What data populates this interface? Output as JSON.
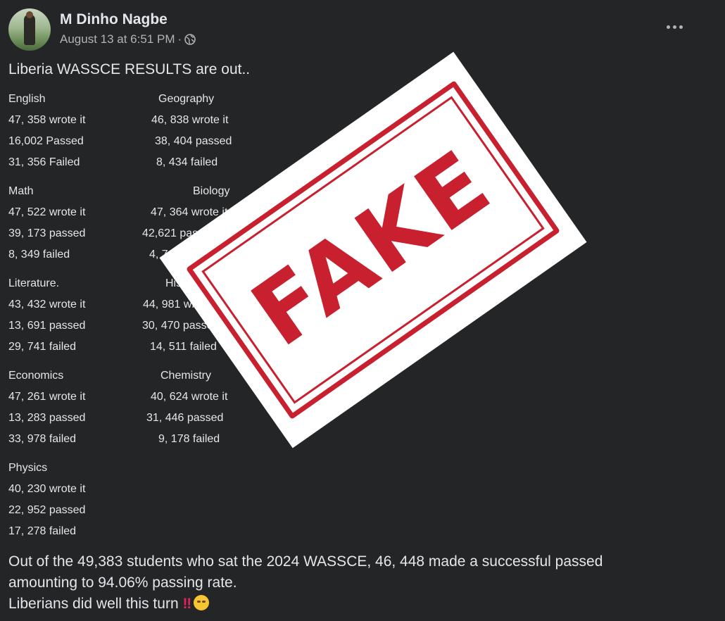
{
  "post": {
    "author": "M Dinho Nagbe",
    "date": "August 13 at 6:51 PM",
    "separator": "·",
    "intro": "Liberia WASSCE RESULTS are out.."
  },
  "subjects": [
    {
      "left": {
        "name": "English",
        "wrote": "47, 358 wrote it",
        "passed": "16,002 Passed",
        "failed": "31, 356 Failed"
      },
      "right": {
        "name": "Geography",
        "wrote": "46, 838 wrote it",
        "passed": "38, 404 passed",
        "failed": "8, 434 failed"
      }
    },
    {
      "left": {
        "name": "Math",
        "wrote": "47, 522 wrote it",
        "passed": "39, 173 passed",
        "failed": "8, 349 failed"
      },
      "right": {
        "name": "Biology",
        "wrote": "47, 364 wrote it",
        "passed": "42,621 passed",
        "failed": "4, 743 failed"
      }
    },
    {
      "left": {
        "name": "Literature.",
        "wrote": "43, 432 wrote it",
        "passed": "13, 691 passed",
        "failed": "29, 741 failed"
      },
      "right": {
        "name": "History",
        "wrote": "44, 981 wrote it",
        "passed": "30, 470 passed",
        "failed": "14, 511 failed"
      }
    },
    {
      "left": {
        "name": "Economics",
        "wrote": "47, 261 wrote it",
        "passed": "13, 283 passed",
        "failed": "33, 978 failed"
      },
      "right": {
        "name": "Chemistry",
        "wrote": "40, 624 wrote it",
        "passed": "31, 446 passed",
        "failed": "9, 178 failed"
      }
    },
    {
      "left": {
        "name": "Physics",
        "wrote": "40, 230 wrote it",
        "passed": "22, 952 passed",
        "failed": "17, 278 failed"
      }
    }
  ],
  "summary": {
    "line1": "Out of the 49,383 students who sat  the  2024 WASSCE, 46, 448 made a successful passed",
    "line2": "amounting to 94.06% passing rate.",
    "line3": "Liberians did well this turn",
    "emoji_bang": "‼"
  },
  "stamp": {
    "text": "FAKE",
    "color": "#c8202f"
  },
  "colors": {
    "background": "#242526",
    "text": "#e4e6eb",
    "secondary": "#b0b3b8"
  }
}
